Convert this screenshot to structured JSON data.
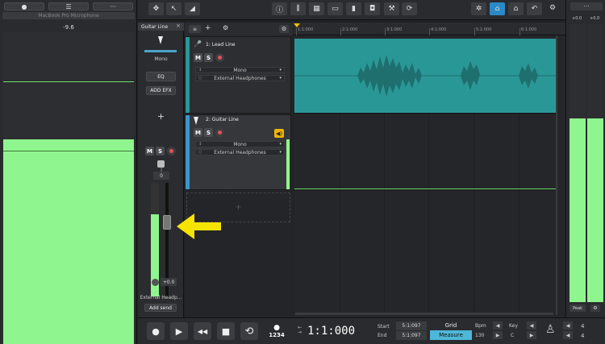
{
  "left_panel": {
    "tabs": [
      "●",
      "☰",
      "···"
    ],
    "device_name": "MacBook Pro Microphone",
    "level_db": "-9.6"
  },
  "toolbar": {
    "buttons": [
      "move-tool",
      "pointer-tool",
      "automation-tool",
      "info",
      "mixer",
      "effects",
      "keyboard",
      "metronome-device",
      "tuner",
      "tools",
      "loop",
      "compress",
      "sync",
      "home",
      "undo",
      "settings"
    ]
  },
  "channel_strip": {
    "title": "Guitar Line",
    "close": "×",
    "mode": "Mono",
    "eq_label": "EQ",
    "fx_label": "ADD EFX",
    "plus": "+",
    "mute": "M",
    "solo": "S",
    "gain_value": "0",
    "volume_value": "+0.0",
    "output_name": "External Headp...",
    "add_send_label": "Add send"
  },
  "track_header_toolbar": {
    "filter": "≡",
    "add_track": "+",
    "settings": "⚙"
  },
  "tracks": [
    {
      "name": "1: Lead Line",
      "mute": "M",
      "solo": "S",
      "input": "Mono",
      "output": "External Headphones",
      "color": "#2a9797"
    },
    {
      "name": "2: Guitar Line",
      "mute": "M",
      "solo": "S",
      "input": "Mono",
      "output": "External Headphones",
      "color": "#3a97c9"
    }
  ],
  "empty_track": {
    "plus": "+"
  },
  "ruler": {
    "labels": [
      "1:1:000",
      "2:1:000",
      "3:1:000",
      "4:1:000",
      "5:1:000",
      "6:1:000"
    ]
  },
  "right_panel": {
    "tab": "···",
    "db_left": "+0.0",
    "db_right": "+0.0",
    "peak_label": "Peak",
    "gear": "⚙"
  },
  "transport": {
    "record": "●",
    "play": "▶",
    "rewind": "◀◀",
    "stop": "■",
    "loop": "⟲",
    "count_in_top": "●",
    "count_in": "1234",
    "position": "1:1:000",
    "start_label": "Start",
    "start_value": "5:1:097",
    "end_label": "End",
    "end_value": "5:1:097",
    "grid_label": "Grid",
    "measure_label": "Measure",
    "bpm_label": "Bpm",
    "bpm_value": "130",
    "key_label": "Key",
    "key_value": "C",
    "time_sig_top": "4",
    "time_sig_bottom": "4"
  },
  "colors": {
    "meter_green": "#8ff68f",
    "clip_teal": "#2a9797",
    "accent_blue": "#4eb7d8",
    "arrow_yellow": "#f5e400"
  }
}
